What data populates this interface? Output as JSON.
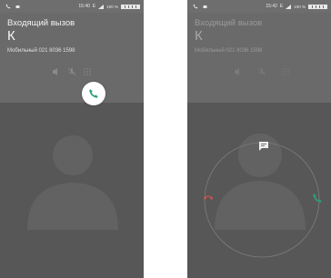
{
  "screens": [
    {
      "status": {
        "time": "15:40",
        "network": "E",
        "battery": "100 %"
      },
      "call": {
        "title": "Входящий вызов",
        "caller": "К",
        "number": "Мобильный 021 8036 1598"
      }
    },
    {
      "status": {
        "time": "15:42",
        "network": "E",
        "battery": "100 %"
      },
      "call": {
        "title": "Входящий вызов",
        "caller": "К",
        "number": "Мобильный 021 8036 1598"
      }
    }
  ],
  "icons": {
    "answer": "phone-icon",
    "decline": "phone-hangup-icon",
    "message": "message-icon",
    "speaker": "speaker-icon",
    "mic": "mic-off-icon",
    "keypad": "dialpad-icon"
  },
  "colors": {
    "header_bg": "#6a6a6a",
    "body_bg": "#575757",
    "status_bg": "#6e6e6e",
    "answer_green": "#2e9e7c",
    "decline_red": "#d9534f"
  }
}
